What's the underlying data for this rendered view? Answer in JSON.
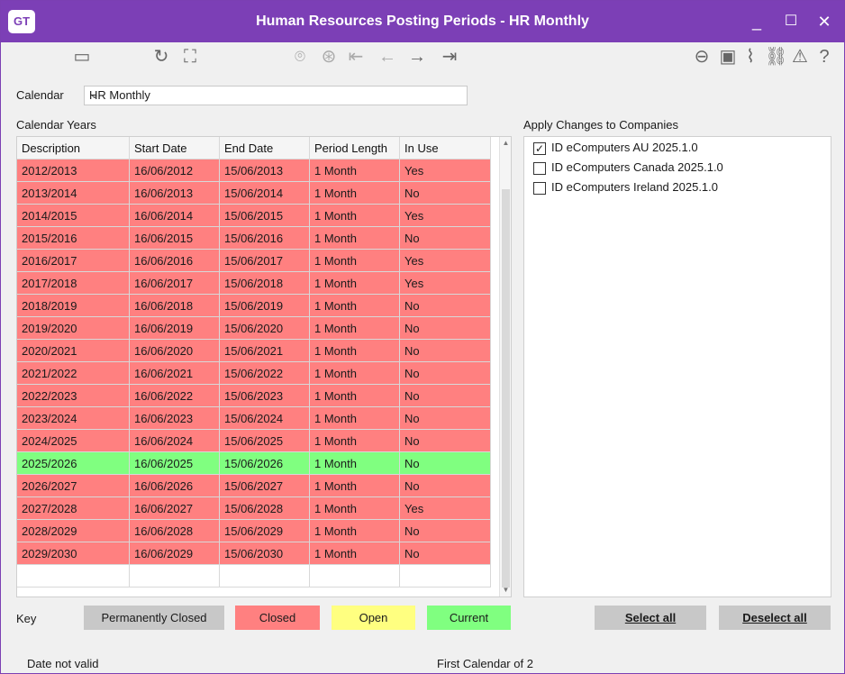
{
  "window": {
    "title": "Human Resources Posting Periods - HR Monthly",
    "logo": "GT",
    "minimize": "_",
    "maximize": "☐",
    "close": "✕"
  },
  "toolbar": {
    "icons": [
      "save-icon",
      "refresh-icon",
      "reconnect-icon",
      "binoculars-icon",
      "filter-icon",
      "first-record-icon",
      "previous-record-icon",
      "next-record-icon",
      "last-record-icon",
      "back-icon",
      "attach-icon",
      "clip-icon",
      "link-icon",
      "alert-icon",
      "help-icon"
    ]
  },
  "form": {
    "calendar_label": "Calendar",
    "calendar_value": "HR Monthly",
    "calendar_years_label": "Calendar Years",
    "companies_label": "Apply Changes to Companies"
  },
  "table": {
    "columns": [
      "Description",
      "Start Date",
      "End Date",
      "Period Length",
      "In Use"
    ],
    "rows": [
      {
        "desc": "2012/2013",
        "start": "16/06/2012",
        "end": "15/06/2013",
        "length": "1 Month",
        "inuse": "Yes",
        "status": "closed"
      },
      {
        "desc": "2013/2014",
        "start": "16/06/2013",
        "end": "15/06/2014",
        "length": "1 Month",
        "inuse": "No",
        "status": "closed"
      },
      {
        "desc": "2014/2015",
        "start": "16/06/2014",
        "end": "15/06/2015",
        "length": "1 Month",
        "inuse": "Yes",
        "status": "closed"
      },
      {
        "desc": "2015/2016",
        "start": "16/06/2015",
        "end": "15/06/2016",
        "length": "1 Month",
        "inuse": "No",
        "status": "closed"
      },
      {
        "desc": "2016/2017",
        "start": "16/06/2016",
        "end": "15/06/2017",
        "length": "1 Month",
        "inuse": "Yes",
        "status": "closed"
      },
      {
        "desc": "2017/2018",
        "start": "16/06/2017",
        "end": "15/06/2018",
        "length": "1 Month",
        "inuse": "Yes",
        "status": "closed"
      },
      {
        "desc": "2018/2019",
        "start": "16/06/2018",
        "end": "15/06/2019",
        "length": "1 Month",
        "inuse": "No",
        "status": "closed"
      },
      {
        "desc": "2019/2020",
        "start": "16/06/2019",
        "end": "15/06/2020",
        "length": "1 Month",
        "inuse": "No",
        "status": "closed"
      },
      {
        "desc": "2020/2021",
        "start": "16/06/2020",
        "end": "15/06/2021",
        "length": "1 Month",
        "inuse": "No",
        "status": "closed"
      },
      {
        "desc": "2021/2022",
        "start": "16/06/2021",
        "end": "15/06/2022",
        "length": "1 Month",
        "inuse": "No",
        "status": "closed"
      },
      {
        "desc": "2022/2023",
        "start": "16/06/2022",
        "end": "15/06/2023",
        "length": "1 Month",
        "inuse": "No",
        "status": "closed"
      },
      {
        "desc": "2023/2024",
        "start": "16/06/2023",
        "end": "15/06/2024",
        "length": "1 Month",
        "inuse": "No",
        "status": "closed"
      },
      {
        "desc": "2024/2025",
        "start": "16/06/2024",
        "end": "15/06/2025",
        "length": "1 Month",
        "inuse": "No",
        "status": "closed"
      },
      {
        "desc": "2025/2026",
        "start": "16/06/2025",
        "end": "15/06/2026",
        "length": "1 Month",
        "inuse": "No",
        "status": "current"
      },
      {
        "desc": "2026/2027",
        "start": "16/06/2026",
        "end": "15/06/2027",
        "length": "1 Month",
        "inuse": "No",
        "status": "closed"
      },
      {
        "desc": "2027/2028",
        "start": "16/06/2027",
        "end": "15/06/2028",
        "length": "1 Month",
        "inuse": "Yes",
        "status": "closed"
      },
      {
        "desc": "2028/2029",
        "start": "16/06/2028",
        "end": "15/06/2029",
        "length": "1 Month",
        "inuse": "No",
        "status": "closed"
      },
      {
        "desc": "2029/2030",
        "start": "16/06/2029",
        "end": "15/06/2030",
        "length": "1 Month",
        "inuse": "No",
        "status": "closed"
      }
    ]
  },
  "companies": [
    {
      "name": "ID eComputers AU 2025.1.0",
      "checked": true
    },
    {
      "name": "ID eComputers Canada 2025.1.0",
      "checked": false
    },
    {
      "name": "ID eComputers Ireland 2025.1.0",
      "checked": false
    }
  ],
  "key": {
    "label": "Key",
    "items": [
      {
        "label": "Permanently Closed",
        "color": "#c8c8c8"
      },
      {
        "label": "Closed",
        "color": "#ff8080"
      },
      {
        "label": "Open",
        "color": "#ffff80"
      },
      {
        "label": "Current",
        "color": "#80ff80"
      }
    ]
  },
  "buttons": {
    "select_all": "Select all",
    "deselect_all": "Deselect all"
  },
  "status": {
    "left": "Date not valid",
    "center": "First Calendar of 2"
  }
}
